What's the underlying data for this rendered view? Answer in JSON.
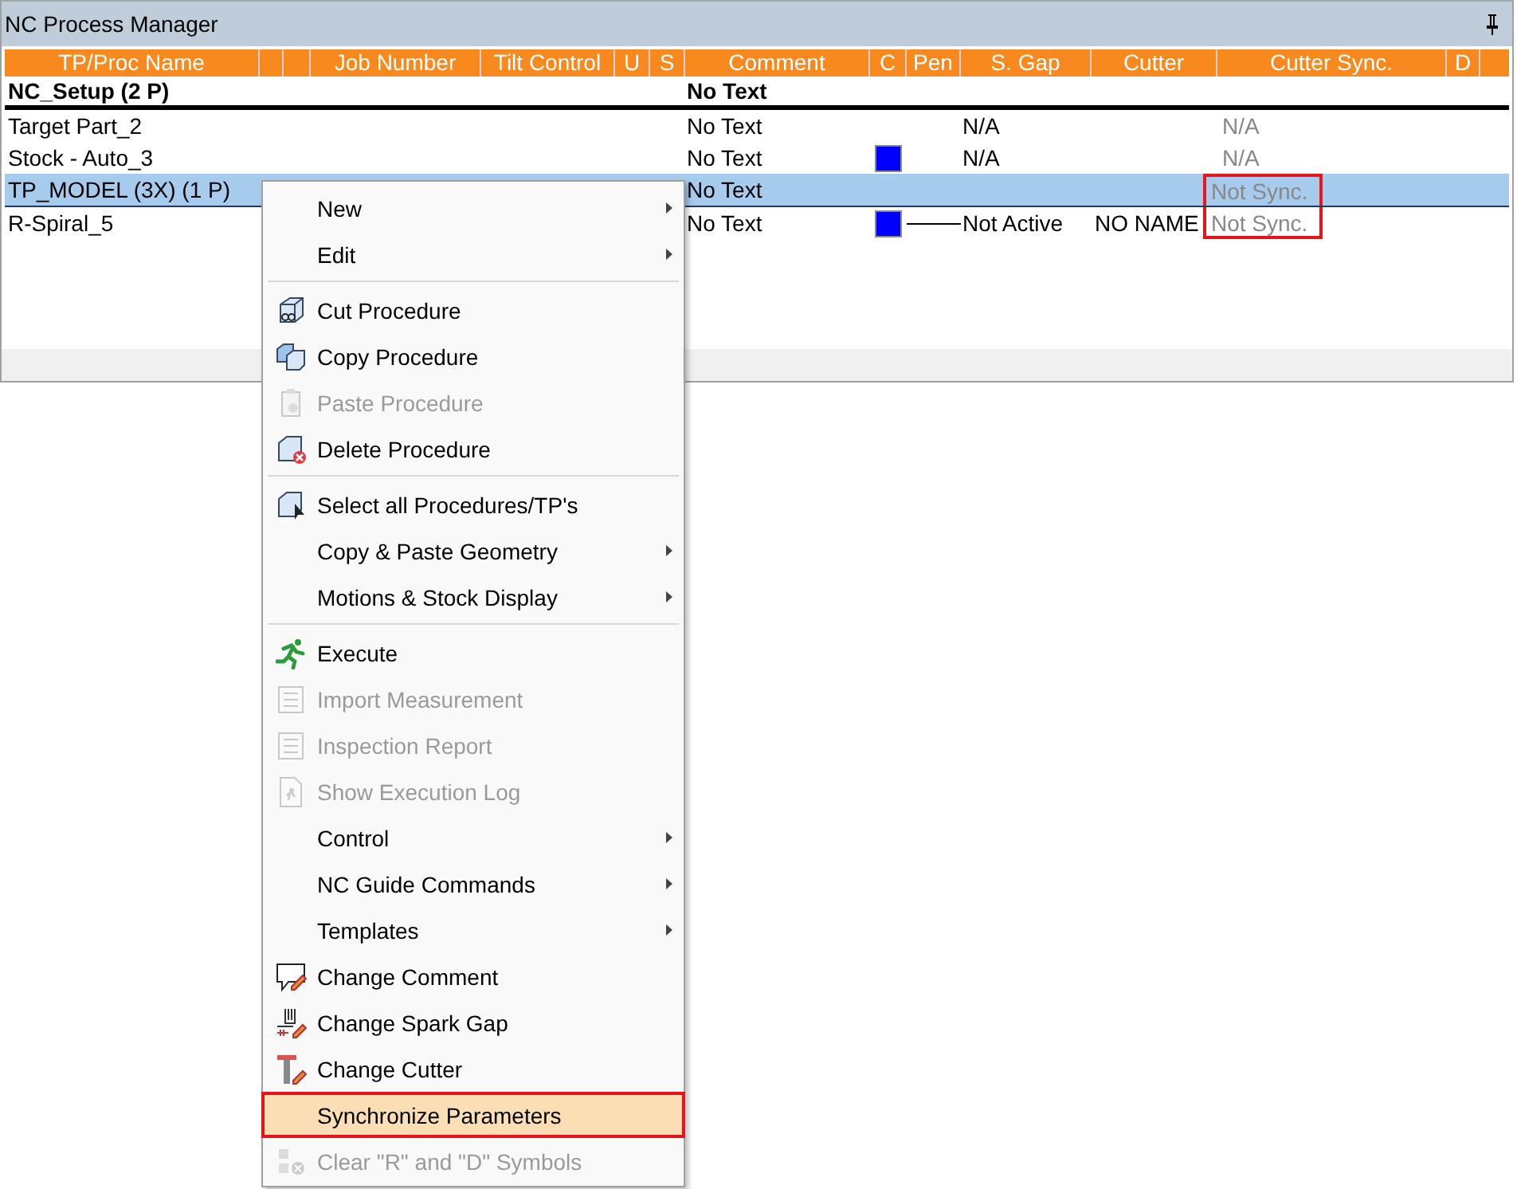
{
  "window": {
    "title": "NC Process Manager"
  },
  "table": {
    "columns": [
      "TP/Proc Name",
      "Job  Number",
      "Tilt Control",
      "U",
      "S",
      "Comment",
      "C",
      "Pen",
      "S. Gap",
      "Cutter",
      "Cutter Sync.",
      "D"
    ],
    "rows": [
      {
        "kind": "group",
        "name": "NC_Setup (2 P)",
        "comment": "No Text",
        "selected": false
      },
      {
        "kind": "item",
        "name": "Target Part_2",
        "comment": "No Text",
        "s_gap": "N/A",
        "cutter_sync": "N/A",
        "flagged": false,
        "selected": false
      },
      {
        "kind": "item",
        "name": "Stock - Auto_3",
        "comment": "No Text",
        "color": "#0000ff",
        "s_gap": "N/A",
        "cutter_sync": "N/A",
        "flagged": false,
        "selected": false
      },
      {
        "kind": "item",
        "name": "TP_MODEL (3X) (1 P)",
        "comment": "No Text",
        "cutter_sync": "Not Sync.",
        "flagged": true,
        "selected": true
      },
      {
        "kind": "item",
        "name": "R-Spiral_5",
        "comment": "No Text",
        "color": "#0000ff",
        "pen": true,
        "s_gap": "Not Active",
        "cutter": "NO NAME",
        "cutter_sync": "Not Sync.",
        "flagged": true,
        "selected": false
      }
    ]
  },
  "context_menu": {
    "items": [
      {
        "kind": "submenu",
        "label": "New",
        "disabled": false,
        "selected": false
      },
      {
        "kind": "submenu",
        "label": "Edit",
        "disabled": false,
        "selected": false
      },
      {
        "kind": "separator"
      },
      {
        "kind": "command",
        "label": "Cut  Procedure",
        "disabled": false,
        "selected": false
      },
      {
        "kind": "command",
        "label": "Copy Procedure",
        "disabled": false,
        "selected": false
      },
      {
        "kind": "command",
        "label": "Paste Procedure",
        "disabled": true,
        "selected": false
      },
      {
        "kind": "command",
        "label": "Delete Procedure",
        "disabled": false,
        "selected": false
      },
      {
        "kind": "separator"
      },
      {
        "kind": "command",
        "label": "Select all Procedures/TP's",
        "disabled": false,
        "selected": false
      },
      {
        "kind": "submenu",
        "label": "Copy & Paste Geometry",
        "disabled": false,
        "selected": false
      },
      {
        "kind": "submenu",
        "label": "Motions & Stock Display",
        "disabled": false,
        "selected": false
      },
      {
        "kind": "separator"
      },
      {
        "kind": "command",
        "label": "Execute",
        "disabled": false,
        "selected": false
      },
      {
        "kind": "command",
        "label": "Import Measurement",
        "disabled": true,
        "selected": false
      },
      {
        "kind": "command",
        "label": "Inspection Report",
        "disabled": true,
        "selected": false
      },
      {
        "kind": "command",
        "label": "Show Execution Log",
        "disabled": true,
        "selected": false
      },
      {
        "kind": "submenu",
        "label": "Control",
        "disabled": false,
        "selected": false
      },
      {
        "kind": "submenu",
        "label": "NC Guide Commands",
        "disabled": false,
        "selected": false
      },
      {
        "kind": "submenu",
        "label": "Templates",
        "disabled": false,
        "selected": false
      },
      {
        "kind": "command",
        "label": "Change Comment",
        "disabled": false,
        "selected": false
      },
      {
        "kind": "command",
        "label": "Change Spark Gap",
        "disabled": false,
        "selected": false
      },
      {
        "kind": "command",
        "label": "Change Cutter",
        "disabled": false,
        "selected": false
      },
      {
        "kind": "command",
        "label": "Synchronize Parameters",
        "disabled": false,
        "selected": true
      },
      {
        "kind": "command",
        "label": "Clear \"R\" and \"D\" Symbols",
        "disabled": true,
        "selected": false
      }
    ]
  }
}
